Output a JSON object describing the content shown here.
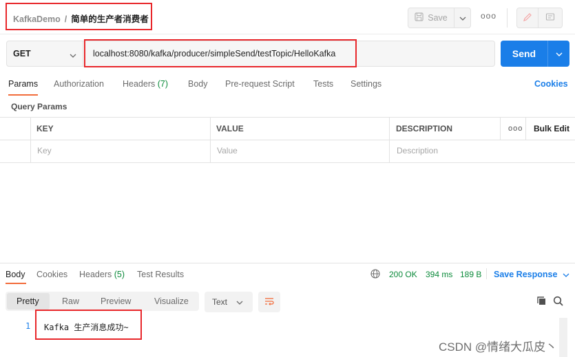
{
  "header": {
    "collection": "KafkaDemo",
    "separator": "/",
    "request_name": "简单的生产者消费者",
    "save_label": "Save",
    "more_label": "ooo"
  },
  "request": {
    "method": "GET",
    "url": "localhost:8080/kafka/producer/simpleSend/testTopic/HelloKafka",
    "send_label": "Send"
  },
  "request_tabs": {
    "params": "Params",
    "authorization": "Authorization",
    "headers": "Headers",
    "headers_count": "(7)",
    "body": "Body",
    "pre_request": "Pre-request Script",
    "tests": "Tests",
    "settings": "Settings",
    "cookies": "Cookies"
  },
  "query_params": {
    "title": "Query Params",
    "columns": [
      "KEY",
      "VALUE",
      "DESCRIPTION"
    ],
    "more": "ooo",
    "bulk_edit": "Bulk Edit",
    "placeholders": [
      "Key",
      "Value",
      "Description"
    ]
  },
  "response": {
    "tabs": {
      "body": "Body",
      "cookies": "Cookies",
      "headers": "Headers",
      "headers_count": "(5)",
      "test_results": "Test Results"
    },
    "status": "200 OK",
    "time": "394 ms",
    "size": "189 B",
    "save_response": "Save Response",
    "formats": [
      "Pretty",
      "Raw",
      "Preview",
      "Visualize"
    ],
    "content_type": "Text",
    "lines": [
      {
        "no": "1",
        "text": "Kafka 生产消息成功~"
      }
    ]
  },
  "watermark": "CSDN @情绪大瓜皮丶",
  "colors": {
    "accent_blue": "#1a7ee8",
    "status_green": "#0b8a3a",
    "tab_active_underline": "#f26b3a",
    "annotation_red": "#e8262a"
  }
}
